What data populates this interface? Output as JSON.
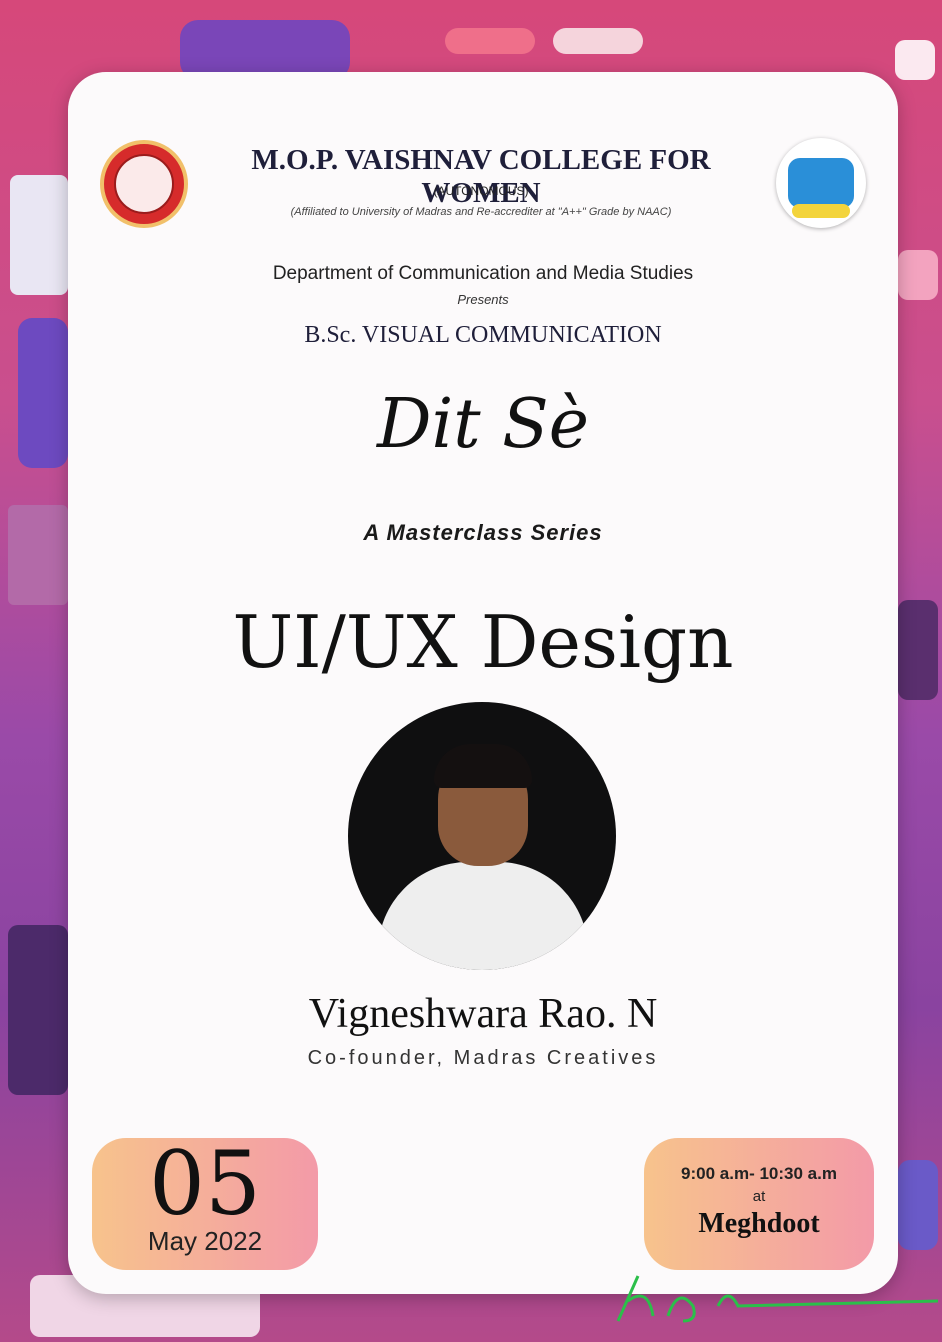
{
  "college": {
    "name": "M.O.P. VAISHNAV COLLEGE FOR WOMEN",
    "status": "(AUTONOMOUS)",
    "affiliation": "(Affiliated to University of Madras and Re-accrediter at \"A++\" Grade by NAAC)"
  },
  "department": "Department of Communication and Media Studies",
  "presents": "Presents",
  "programme": "B.Sc. VISUAL COMMUNICATION",
  "series_logo": "Dit Sè",
  "series_subtitle": "A Masterclass Series",
  "event_title": "UI/UX Design",
  "speaker": {
    "name": "Vigneshwara Rao. N",
    "role": "Co-founder, Madras Creatives"
  },
  "date": {
    "day": "05",
    "month_year": "May 2022"
  },
  "time": {
    "range": "9:00 a.m- 10:30 a.m",
    "at": "at",
    "venue": "Meghdoot"
  },
  "colors": {
    "accent_gradient_start": "#f7c38c",
    "accent_gradient_end": "#f39aa8",
    "background": "#c94f8e"
  }
}
